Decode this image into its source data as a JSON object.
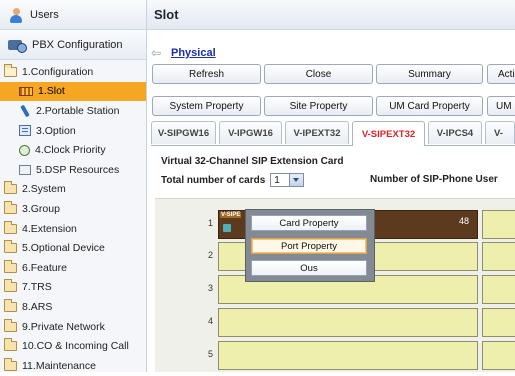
{
  "sidebar": {
    "header_users": "Users",
    "header_pbx": "PBX Configuration",
    "tree": [
      {
        "label": "1.Configuration",
        "icon": "folder-open-icon",
        "level": 1,
        "selected": false
      },
      {
        "label": "1.Slot",
        "icon": "slot-icon",
        "level": 2,
        "selected": true
      },
      {
        "label": "2.Portable Station",
        "icon": "portable-station-icon",
        "level": 2,
        "selected": false
      },
      {
        "label": "3.Option",
        "icon": "option-icon",
        "level": 2,
        "selected": false
      },
      {
        "label": "4.Clock Priority",
        "icon": "clock-icon",
        "level": 2,
        "selected": false
      },
      {
        "label": "5.DSP Resources",
        "icon": "dsp-icon",
        "level": 2,
        "selected": false
      },
      {
        "label": "2.System",
        "icon": "folder-icon",
        "level": 1,
        "selected": false
      },
      {
        "label": "3.Group",
        "icon": "folder-icon",
        "level": 1,
        "selected": false
      },
      {
        "label": "4.Extension",
        "icon": "folder-icon",
        "level": 1,
        "selected": false
      },
      {
        "label": "5.Optional Device",
        "icon": "folder-icon",
        "level": 1,
        "selected": false
      },
      {
        "label": "6.Feature",
        "icon": "folder-icon",
        "level": 1,
        "selected": false
      },
      {
        "label": "7.TRS",
        "icon": "folder-icon",
        "level": 1,
        "selected": false
      },
      {
        "label": "8.ARS",
        "icon": "folder-icon",
        "level": 1,
        "selected": false
      },
      {
        "label": "9.Private Network",
        "icon": "folder-icon",
        "level": 1,
        "selected": false
      },
      {
        "label": "10.CO & Incoming Call",
        "icon": "folder-icon",
        "level": 1,
        "selected": false
      },
      {
        "label": "11.Maintenance",
        "icon": "folder-icon",
        "level": 1,
        "selected": false
      }
    ]
  },
  "main": {
    "title": "Slot",
    "back_link": "Physical",
    "toolbar1": [
      "Refresh",
      "Close",
      "Summary",
      "Acti"
    ],
    "toolbar2": [
      "System Property",
      "Site Property",
      "UM Card Property",
      "UM P"
    ],
    "tabs": [
      "V-SIPGW16",
      "V-IPGW16",
      "V-IPEXT32",
      "V-SIPEXT32",
      "V-IPCS4",
      "V-"
    ],
    "active_tab": "V-SIPEXT32",
    "card_title": "Virtual 32-Channel SIP Extension Card",
    "total_label": "Total number of cards",
    "total_value": "1",
    "sip_label": "Number of SIP-Phone User",
    "slots": [
      "1",
      "2",
      "3",
      "4",
      "5"
    ],
    "card": {
      "tag": "V-SIPE",
      "count": "48"
    },
    "context_menu": [
      "Card Property",
      "Port Property",
      "Ous"
    ],
    "context_highlight": "Port Property"
  },
  "colors": {
    "accent_selected": "#f5a623",
    "active_tab_text": "#d6232a",
    "link": "#1a2fa8"
  }
}
